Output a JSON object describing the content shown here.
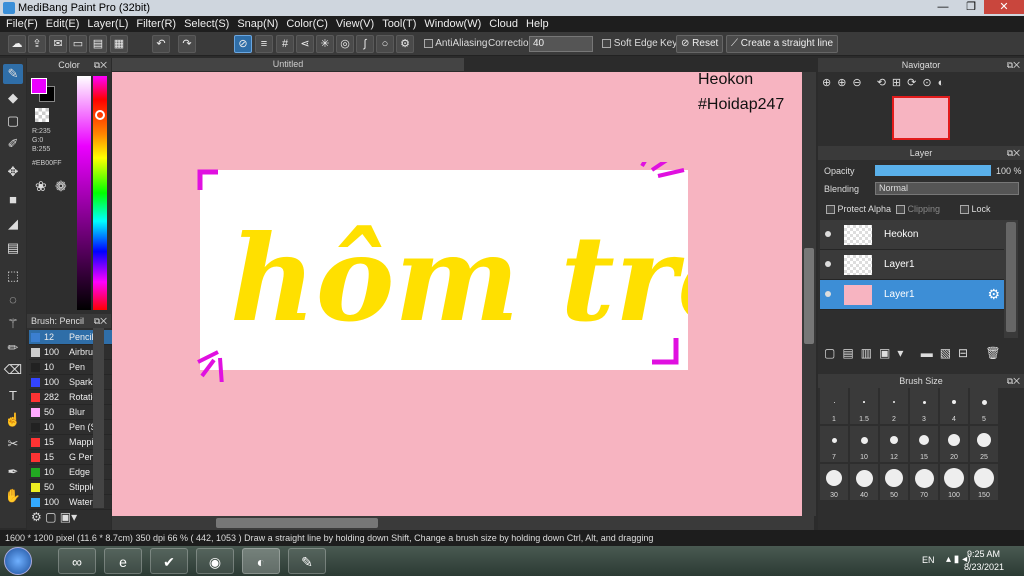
{
  "window": {
    "title": "MediBang Paint Pro (32bit)",
    "minimize": "—",
    "maximize": "❐",
    "close": "✕"
  },
  "menu": [
    "File(F)",
    "Edit(E)",
    "Layer(L)",
    "Filter(R)",
    "Select(S)",
    "Snap(N)",
    "Color(C)",
    "View(V)",
    "Tool(T)",
    "Window(W)",
    "Cloud",
    "Help"
  ],
  "toolbar": {
    "antialiasing_label": "AntiAliasing",
    "correction_label": "Correction",
    "correction_value": "40",
    "soft_edge_label": "Soft Edge",
    "key_label": "Key",
    "reset_label": "Reset",
    "straight_line_label": "Create a straight line"
  },
  "color_panel": {
    "title": "Color",
    "r": "R:235",
    "g": "G:0",
    "b": "B:255",
    "hex": "#EB00FF",
    "fg_color": "#EB00FF"
  },
  "brush_panel": {
    "title": "Brush: Pencil",
    "items": [
      {
        "size": "12",
        "name": "Pencil",
        "color": "#3b7fd0"
      },
      {
        "size": "100",
        "name": "Airbrush",
        "color": "#cccccc"
      },
      {
        "size": "10",
        "name": "Pen",
        "color": "#222222"
      },
      {
        "size": "100",
        "name": "Sparkle",
        "color": "#3344ff"
      },
      {
        "size": "282",
        "name": "Rotation",
        "color": "#ff3333"
      },
      {
        "size": "50",
        "name": "Blur",
        "color": "#ffaaff"
      },
      {
        "size": "10",
        "name": "Pen (S)",
        "color": "#222222"
      },
      {
        "size": "15",
        "name": "Mapping",
        "color": "#ff3333"
      },
      {
        "size": "15",
        "name": "G Pen",
        "color": "#ff3333"
      },
      {
        "size": "10",
        "name": "Edge",
        "color": "#22aa22"
      },
      {
        "size": "50",
        "name": "Stipple",
        "color": "#eeee22"
      },
      {
        "size": "100",
        "name": "Watercolor",
        "color": "#33aaff"
      }
    ]
  },
  "canvas": {
    "tab_title": "Untitled",
    "watermark_line1": "Heokon",
    "watermark_line2": "#Hoidap247",
    "artwork_text": "hôm trời",
    "artwork_color": "#ffe000",
    "background_color": "#f7b4c1"
  },
  "navigator": {
    "title": "Navigator"
  },
  "layer_panel": {
    "title": "Layer",
    "opacity_label": "Opacity",
    "opacity_value": "100 %",
    "opacity_fraction": 1.0,
    "blending_label": "Blending",
    "blending_value": "Normal",
    "protect_alpha_label": "Protect Alpha",
    "clipping_label": "Clipping",
    "lock_label": "Lock",
    "layers": [
      {
        "name": "Heokon"
      },
      {
        "name": "Layer1"
      },
      {
        "name": "Layer1"
      }
    ]
  },
  "brush_size": {
    "title": "Brush Size",
    "sizes": [
      "1",
      "1.5",
      "2",
      "3",
      "4",
      "5",
      "7",
      "10",
      "12",
      "15",
      "20",
      "25",
      "30",
      "40",
      "50",
      "70",
      "100",
      "150"
    ]
  },
  "status": {
    "canvas_size": "1600 * 1200 pixel",
    "physical_size": "(11.6 * 8.7cm)",
    "dpi": "350 dpi",
    "zoom": "66 %",
    "coords": "( 442, 1053 )",
    "hint": "Draw a straight line by holding down Shift, Change a brush size by holding down Ctrl, Alt, and dragging"
  },
  "taskbar": {
    "lang": "EN",
    "time": "9:25 AM",
    "date": "8/23/2021"
  }
}
